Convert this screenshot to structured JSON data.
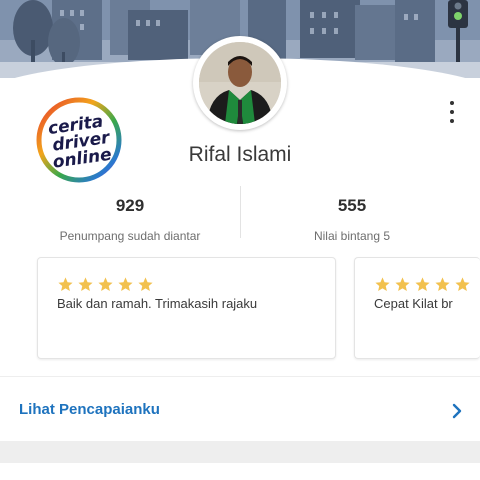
{
  "profile": {
    "name": "Rifal Islami"
  },
  "stats": [
    {
      "value": "929",
      "label": "Penumpang sudah diantar"
    },
    {
      "value": "555",
      "label": "Nilai bintang 5"
    }
  ],
  "reviews": [
    {
      "rating": 5,
      "text": "Baik dan ramah. Trimakasih rajaku"
    },
    {
      "rating": 5,
      "text": "Cepat Kilat br"
    }
  ],
  "achievements": {
    "label": "Lihat Pencapaianku"
  },
  "watermark": {
    "line1": "cerita",
    "line2": "driver",
    "line3": "online"
  },
  "colors": {
    "accent": "#1e73be",
    "star": "#f2c14e",
    "jacket": "#1f8a3c"
  },
  "icons": {
    "menu": "more-vertical-icon",
    "chevron": "chevron-right-icon",
    "star": "star-icon"
  }
}
